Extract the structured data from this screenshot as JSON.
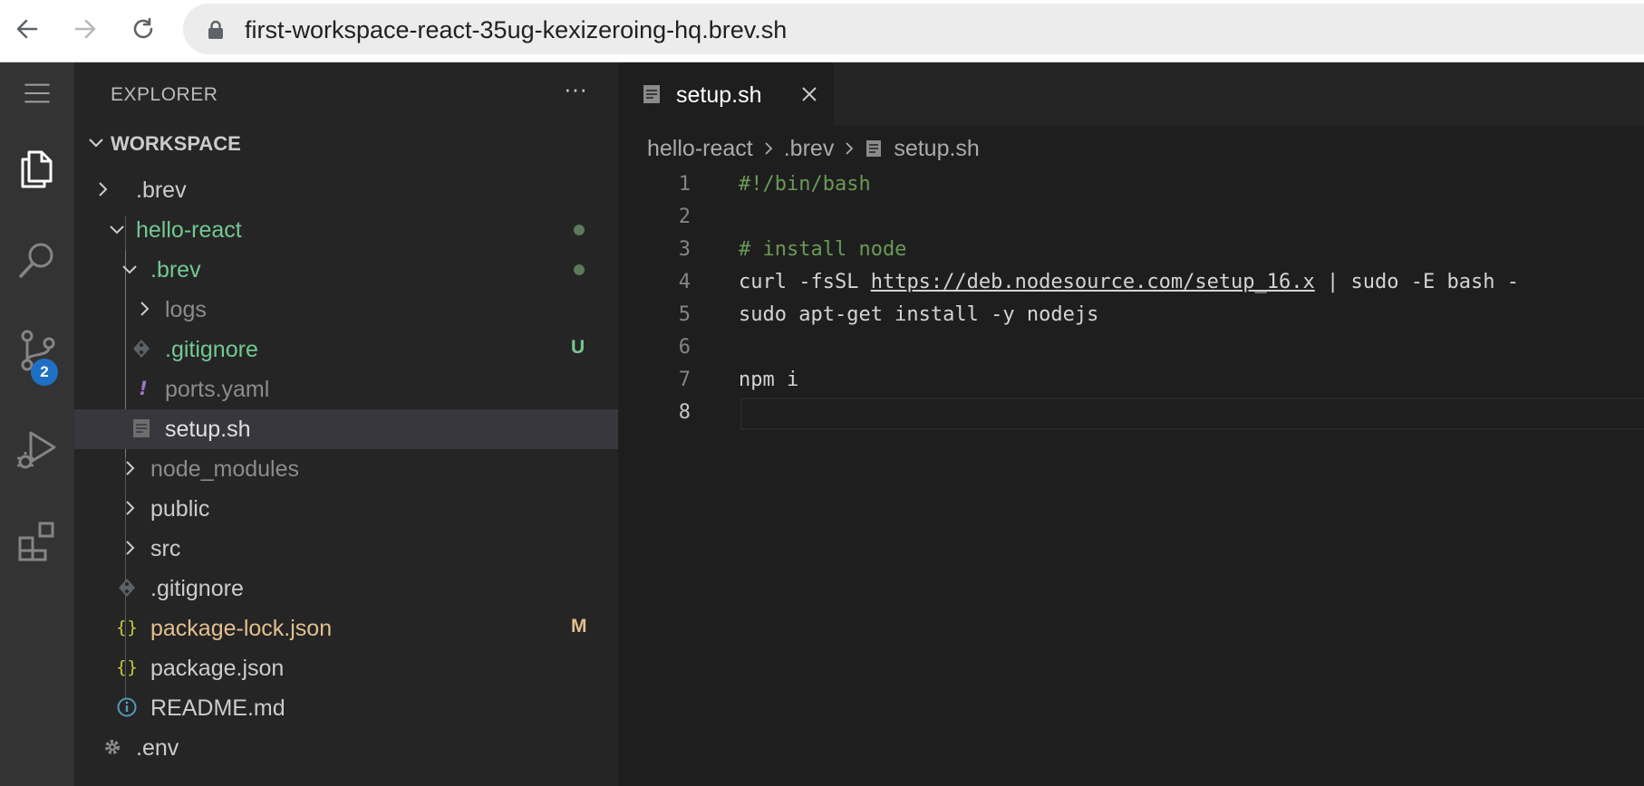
{
  "browser": {
    "url": "first-workspace-react-35ug-kexizeroing-hq.brev.sh"
  },
  "activity_bar": {
    "source_control_badge": "2"
  },
  "sidebar": {
    "title": "EXPLORER",
    "more": "···",
    "workspace_label": "WORKSPACE",
    "tree": [
      {
        "label": ".brev",
        "deco": ""
      },
      {
        "label": "hello-react",
        "deco": ""
      },
      {
        "label": ".brev",
        "deco": ""
      },
      {
        "label": "logs",
        "deco": ""
      },
      {
        "label": ".gitignore",
        "deco": "U"
      },
      {
        "label": "ports.yaml",
        "deco": ""
      },
      {
        "label": "setup.sh",
        "deco": ""
      },
      {
        "label": "node_modules",
        "deco": ""
      },
      {
        "label": "public",
        "deco": ""
      },
      {
        "label": "src",
        "deco": ""
      },
      {
        "label": ".gitignore",
        "deco": ""
      },
      {
        "label": "package-lock.json",
        "deco": "M"
      },
      {
        "label": "package.json",
        "deco": ""
      },
      {
        "label": "README.md",
        "deco": ""
      },
      {
        "label": ".env",
        "deco": ""
      }
    ]
  },
  "editor": {
    "tab_label": "setup.sh",
    "breadcrumb": [
      "hello-react",
      ".brev",
      "setup.sh"
    ],
    "lines": [
      {
        "num": "1",
        "parts": [
          {
            "t": "#!/bin/bash",
            "c": "comment"
          }
        ]
      },
      {
        "num": "2",
        "parts": []
      },
      {
        "num": "3",
        "parts": [
          {
            "t": "# install node",
            "c": "comment"
          }
        ]
      },
      {
        "num": "4",
        "parts": [
          {
            "t": "curl -fsSL ",
            "c": ""
          },
          {
            "t": "https://deb.nodesource.com/setup_16.x",
            "c": "link"
          },
          {
            "t": " | sudo -E bash -",
            "c": ""
          }
        ]
      },
      {
        "num": "5",
        "parts": [
          {
            "t": "sudo apt-get install -y nodejs",
            "c": ""
          }
        ]
      },
      {
        "num": "6",
        "parts": []
      },
      {
        "num": "7",
        "parts": [
          {
            "t": "npm i",
            "c": ""
          }
        ]
      },
      {
        "num": "8",
        "parts": []
      }
    ]
  },
  "colors": {
    "git_untracked": "#73c991",
    "git_modified": "#e2c08d",
    "comment": "#6a9955",
    "badge": "#1f6fc5"
  }
}
